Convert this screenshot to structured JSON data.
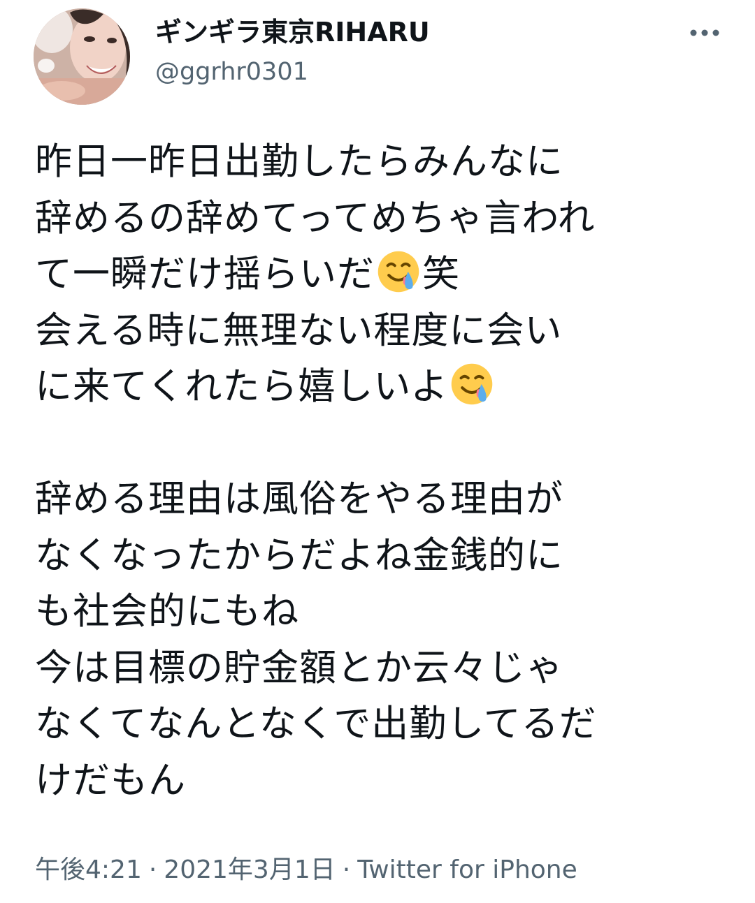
{
  "author": {
    "display_name": "ギンギラ東京RIHARU",
    "handle": "@ggrhr0301",
    "avatar_icon": "profile-photo"
  },
  "more_icon": "more-horizontal-icon",
  "tweet": {
    "lines": [
      {
        "parts": [
          "昨日一昨日出勤したらみんなに"
        ]
      },
      {
        "parts": [
          "辞めるの辞めてってめちゃ言われ"
        ]
      },
      {
        "parts": [
          "て一瞬だけ揺らいだ",
          "{emoji}",
          "笑"
        ]
      },
      {
        "parts": [
          "会える時に無理ない程度に会い"
        ]
      },
      {
        "parts": [
          "に来てくれたら嬉しいよ",
          "{emoji}"
        ]
      },
      {
        "parts": [
          ""
        ]
      },
      {
        "parts": [
          "辞める理由は風俗をやる理由が"
        ]
      },
      {
        "parts": [
          "なくなったからだよね金銭的に"
        ]
      },
      {
        "parts": [
          "も社会的にもね"
        ]
      },
      {
        "parts": [
          "今は目標の貯金額とか云々じゃ"
        ]
      },
      {
        "parts": [
          "なくてなんとなくで出勤してるだ"
        ]
      },
      {
        "parts": [
          "けだもん"
        ]
      }
    ],
    "emoji_name": "smiling-face-with-tear-emoji"
  },
  "meta": {
    "time": "午後4:21",
    "separator": "·",
    "date": "2021年3月1日",
    "source": "Twitter for iPhone"
  },
  "colors": {
    "text": "#0f1419",
    "secondary": "#536471",
    "emoji_face": "#ffcc4d",
    "emoji_tear": "#5dadec"
  }
}
